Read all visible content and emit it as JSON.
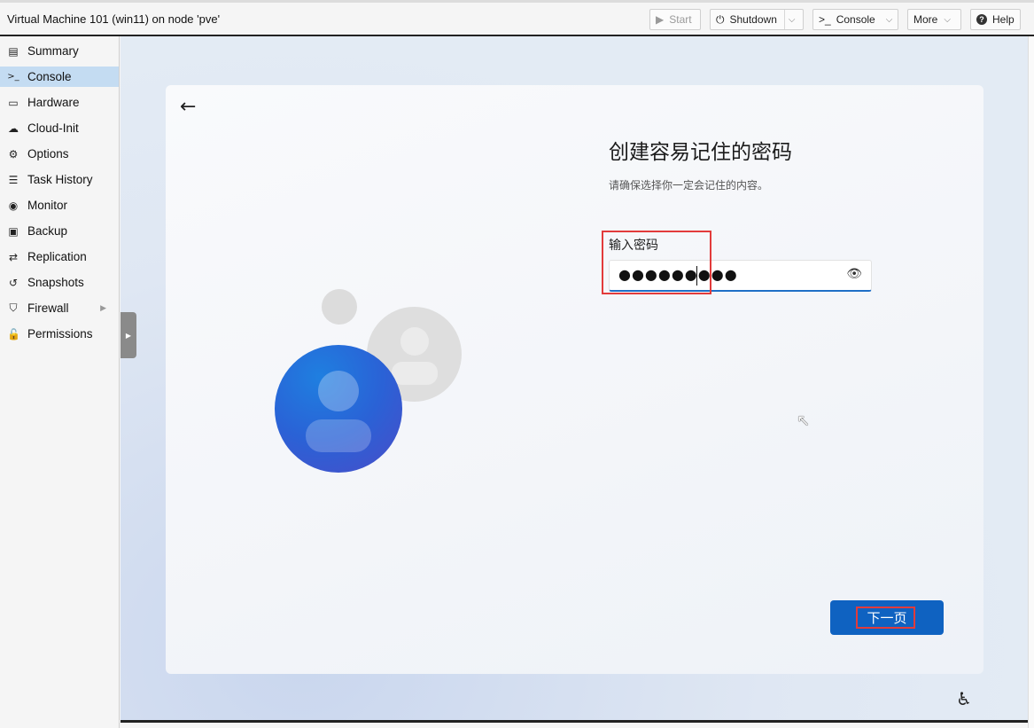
{
  "window": {
    "title": "Virtual Machine 101 (win11) on node 'pve'"
  },
  "toolbar": {
    "start": {
      "label": "Start",
      "icon": "play-icon",
      "icon_glyph": "▶"
    },
    "shutdown": {
      "label": "Shutdown",
      "icon": "power-icon",
      "icon_glyph": "⏻"
    },
    "console": {
      "label": "Console",
      "icon": "terminal-icon",
      "icon_glyph": ">_"
    },
    "more": {
      "label": "More"
    },
    "help": {
      "label": "Help",
      "icon": "help-icon",
      "icon_glyph": "?"
    },
    "chevron_glyph": "⌵"
  },
  "sidebar": {
    "items": [
      {
        "label": "Summary",
        "icon": "book-icon",
        "glyph": "▤"
      },
      {
        "label": "Console",
        "icon": "terminal-icon",
        "glyph": ">_"
      },
      {
        "label": "Hardware",
        "icon": "monitor-icon",
        "glyph": "▭"
      },
      {
        "label": "Cloud-Init",
        "icon": "cloud-icon",
        "glyph": "☁"
      },
      {
        "label": "Options",
        "icon": "gear-icon",
        "glyph": "⚙"
      },
      {
        "label": "Task History",
        "icon": "list-icon",
        "glyph": "☰"
      },
      {
        "label": "Monitor",
        "icon": "eye-icon",
        "glyph": "◉"
      },
      {
        "label": "Backup",
        "icon": "floppy-icon",
        "glyph": "▣"
      },
      {
        "label": "Replication",
        "icon": "retweet-icon",
        "glyph": "⇄"
      },
      {
        "label": "Snapshots",
        "icon": "history-icon",
        "glyph": "↺"
      },
      {
        "label": "Firewall",
        "icon": "shield-icon",
        "glyph": "⛉",
        "caret": "▶"
      },
      {
        "label": "Permissions",
        "icon": "unlock-icon",
        "glyph": "🔓"
      }
    ],
    "selected_index": 1
  },
  "console": {
    "back_glyph": "←",
    "heading": "创建容易记住的密码",
    "subheading": "请确保选择你一定会记住的内容。",
    "password_label": "输入密码",
    "password_value": "●●●●●●●●●",
    "eye_glyph": "👁",
    "next_label": "下一页",
    "cursor_glyph": "↖",
    "accessibility_glyph": "♿"
  },
  "colors": {
    "accent": "#0f62c1",
    "highlight_box": "#e23b3b",
    "sidebar_selected": "#c4dcf2"
  }
}
